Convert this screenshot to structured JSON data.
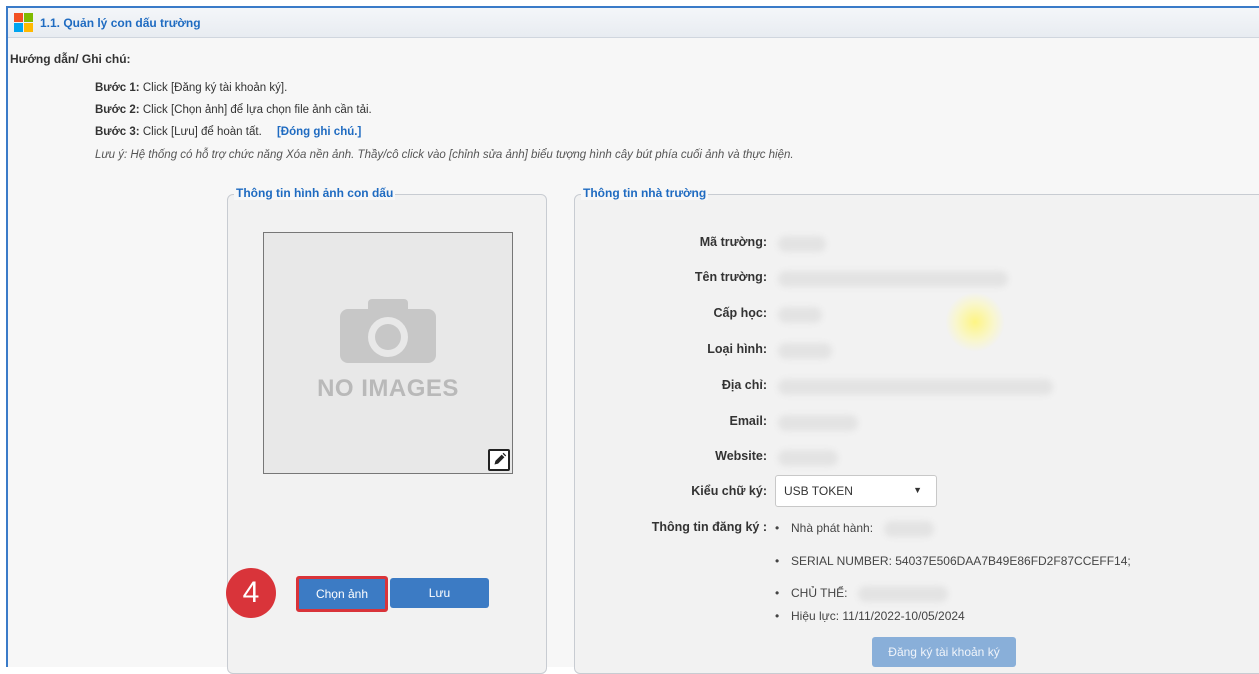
{
  "header": {
    "title": "1.1. Quản lý con dấu trường"
  },
  "guide": {
    "heading": "Hướng dẫn/ Ghi chú:",
    "steps": [
      {
        "label": "Bước 1:",
        "text": "Click [Đăng ký tài khoản ký]."
      },
      {
        "label": "Bước 2:",
        "text": "Click [Chọn ảnh] để lựa chọn file ảnh cần tải."
      },
      {
        "label": "Bước 3:",
        "text": "Click [Lưu] để hoàn tất."
      }
    ],
    "close_link": "[Đóng ghi chú.]",
    "note": "Lưu ý: Hệ thống có hỗ trợ chức năng Xóa nền ảnh. Thầy/cô click vào [chỉnh sửa ảnh] biểu tượng hình cây bút phía cuối ảnh và thực hiện."
  },
  "seal_panel": {
    "legend": "Thông tin hình ảnh con dấu",
    "placeholder_text": "NO IMAGES",
    "choose_button": "Chọn ảnh",
    "save_button": "Lưu",
    "step_badge": "4"
  },
  "school_panel": {
    "legend": "Thông tin nhà trường",
    "fields": [
      {
        "label": "Mã trường:"
      },
      {
        "label": "Tên trường:"
      },
      {
        "label": "Cấp học:"
      },
      {
        "label": "Loại hình:"
      },
      {
        "label": "Địa chỉ:"
      },
      {
        "label": "Email:"
      },
      {
        "label": "Website:"
      }
    ],
    "signature_type_label": "Kiểu chữ ký:",
    "signature_type_value": "USB TOKEN",
    "registration_label": "Thông tin đăng ký :",
    "registration_items": [
      "Nhà phát hành:",
      "SERIAL NUMBER: 54037E506DAA7B49E86FD2F87CCEFF14;",
      "CHỦ THỂ:",
      "Hiệu lực: 11/11/2022-10/05/2024"
    ],
    "register_button": "Đăng ký tài khoản ký"
  },
  "colors": {
    "accent": "#1f6bc1",
    "button": "#3c7bc4",
    "button_disabled": "#89afd9",
    "highlight": "#d9343a"
  }
}
